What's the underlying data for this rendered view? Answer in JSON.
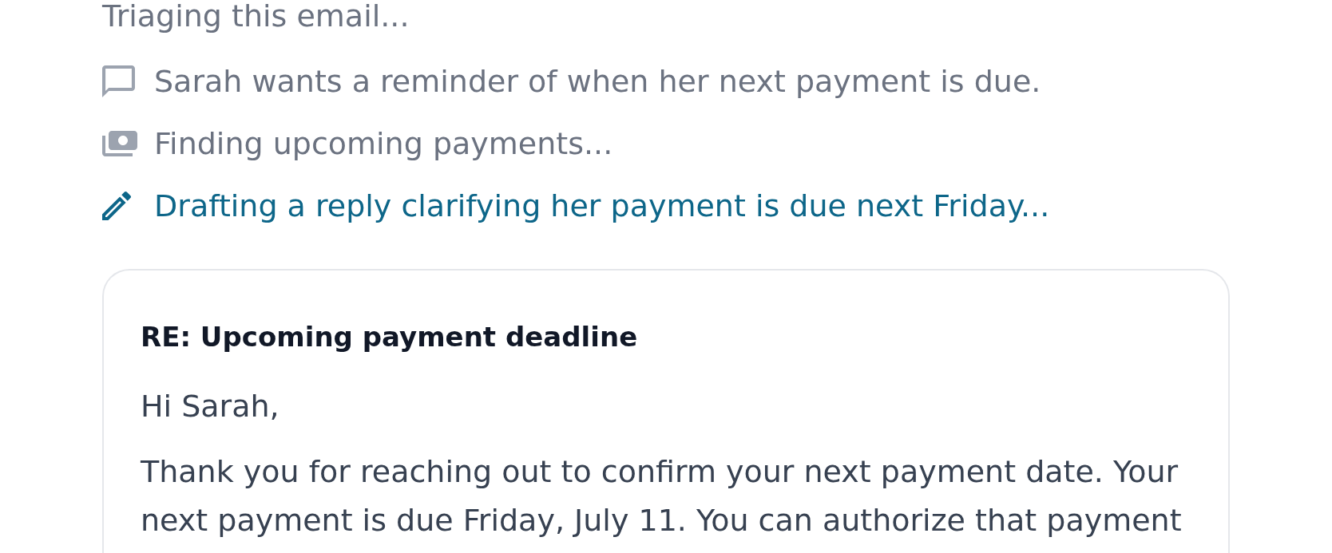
{
  "status": {
    "text": "Triaging this email..."
  },
  "steps": [
    {
      "kind": "message",
      "text": "Sarah wants a reminder of when her next payment is due.",
      "active": false
    },
    {
      "kind": "money",
      "text": "Finding upcoming payments...",
      "active": false
    },
    {
      "kind": "draft",
      "text": "Drafting a reply clarifying her payment is due next Friday...",
      "active": true
    }
  ],
  "draft": {
    "subject": "RE: Upcoming payment deadline",
    "greeting": "Hi Sarah,",
    "body": "Thank you for reaching out to confirm your next payment date. Your next payment is due Friday, July 11. You can authorize that payment"
  }
}
